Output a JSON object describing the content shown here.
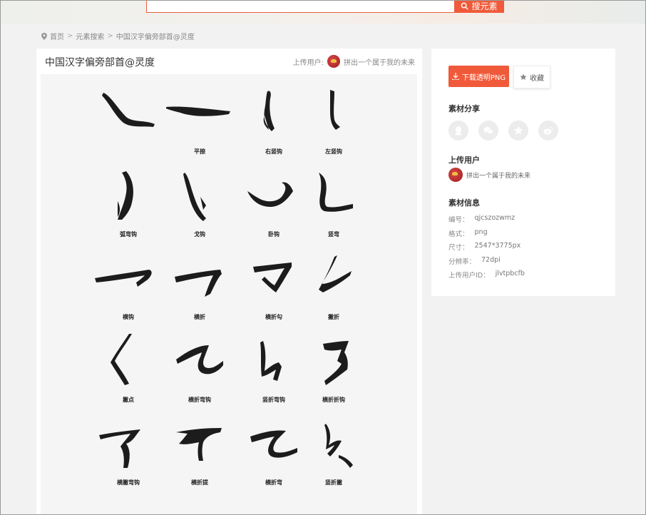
{
  "search": {
    "button_label": "搜元素"
  },
  "breadcrumb": {
    "items": [
      "首页",
      "元素搜索",
      "中国汉字偏旁部首@灵度"
    ]
  },
  "main": {
    "title": "中国汉字偏旁部首@灵度",
    "uploader_prefix": "上传用户:",
    "uploader_name": "拼出一个属于我的未来",
    "strokes": [
      {
        "label": ""
      },
      {
        "label": "平捺"
      },
      {
        "label": "右竖钩"
      },
      {
        "label": "左竖钩"
      },
      {
        "label": "弧弯钩"
      },
      {
        "label": "戈钩"
      },
      {
        "label": "卧钩"
      },
      {
        "label": "竖弯"
      },
      {
        "label": "横钩"
      },
      {
        "label": "横折"
      },
      {
        "label": "横折勾"
      },
      {
        "label": "撇折"
      },
      {
        "label": "撇点"
      },
      {
        "label": "横折弯钩"
      },
      {
        "label": "竖折弯钩"
      },
      {
        "label": "横折折钩"
      },
      {
        "label": "横撇弯钩"
      },
      {
        "label": "横折提"
      },
      {
        "label": "横折弯"
      },
      {
        "label": "竖折撇"
      }
    ]
  },
  "sidebar": {
    "download_label": "下载透明PNG",
    "favorite_label": "收藏",
    "share_title": "素材分享",
    "share_icons": [
      "qq-icon",
      "wechat-icon",
      "qzone-star-icon",
      "weibo-icon"
    ],
    "uploader_title": "上传用户",
    "uploader_name": "拼出一个属于我的未来",
    "info_title": "素材信息",
    "info": [
      {
        "key": "编号：",
        "value": "qjcszozwmz"
      },
      {
        "key": "格式：",
        "value": "png"
      },
      {
        "key": "尺寸：",
        "value": "2547*3775px"
      },
      {
        "key": "分辨率：",
        "value": "72dpi"
      },
      {
        "key": "上传用户ID：",
        "value": "jlvtpbcfb"
      }
    ]
  },
  "colors": {
    "accent": "#f05a3a",
    "ink": "#1c1c1c",
    "card": "#ffffff",
    "page_bg": "#f2f2f2"
  }
}
